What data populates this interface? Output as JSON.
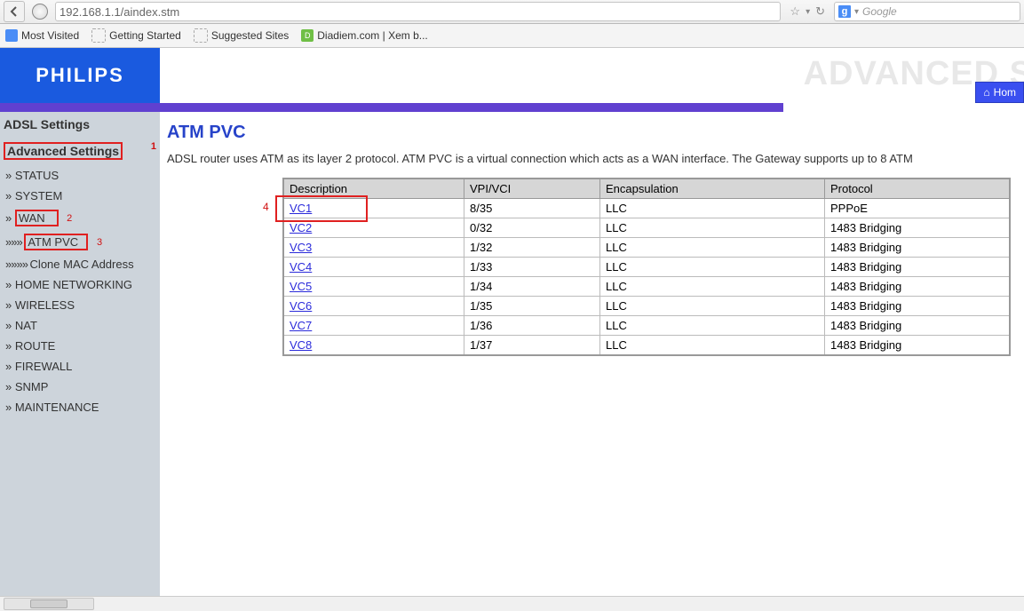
{
  "browser": {
    "url": "192.168.1.1/aindex.stm",
    "search_placeholder": "Google",
    "bookmarks": [
      {
        "label": "Most Visited"
      },
      {
        "label": "Getting Started"
      },
      {
        "label": "Suggested Sites"
      },
      {
        "label": "Diadiem.com | Xem b..."
      }
    ]
  },
  "brand": "PHILIPS",
  "header_advanced_text": "ADVANCED S",
  "home_label": "Hom",
  "sidebar": {
    "heading1": "ADSL Settings",
    "heading2": "Advanced Settings",
    "items": {
      "status": "STATUS",
      "system": "SYSTEM",
      "wan": "WAN",
      "atm_pvc": "ATM PVC",
      "clone_mac": "Clone MAC Address",
      "home_net": "HOME NETWORKING",
      "wireless": "WIRELESS",
      "nat": "NAT",
      "route": "ROUTE",
      "firewall": "FIREWALL",
      "snmp": "SNMP",
      "maintenance": "MAINTENANCE"
    }
  },
  "annotations": {
    "a1": "1",
    "a2": "2",
    "a3": "3",
    "a4": "4"
  },
  "page": {
    "title": "ATM PVC",
    "description": "ADSL router uses ATM as its layer 2 protocol. ATM PVC is a virtual connection which acts as a WAN interface. The Gateway supports up to 8 ATM"
  },
  "table": {
    "headers": {
      "desc": "Description",
      "vpi": "VPI/VCI",
      "enc": "Encapsulation",
      "proto": "Protocol"
    },
    "rows": [
      {
        "desc": "VC1",
        "vpi": "8/35",
        "enc": "LLC",
        "proto": "PPPoE"
      },
      {
        "desc": "VC2",
        "vpi": "0/32",
        "enc": "LLC",
        "proto": "1483 Bridging"
      },
      {
        "desc": "VC3",
        "vpi": "1/32",
        "enc": "LLC",
        "proto": "1483 Bridging"
      },
      {
        "desc": "VC4",
        "vpi": "1/33",
        "enc": "LLC",
        "proto": "1483 Bridging"
      },
      {
        "desc": "VC5",
        "vpi": "1/34",
        "enc": "LLC",
        "proto": "1483 Bridging"
      },
      {
        "desc": "VC6",
        "vpi": "1/35",
        "enc": "LLC",
        "proto": "1483 Bridging"
      },
      {
        "desc": "VC7",
        "vpi": "1/36",
        "enc": "LLC",
        "proto": "1483 Bridging"
      },
      {
        "desc": "VC8",
        "vpi": "1/37",
        "enc": "LLC",
        "proto": "1483 Bridging"
      }
    ]
  }
}
